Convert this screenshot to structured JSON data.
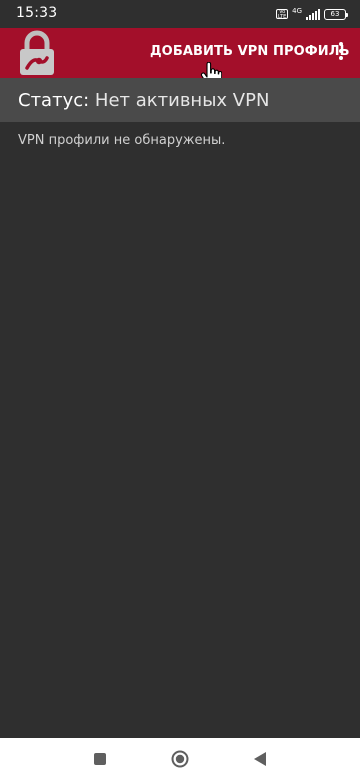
{
  "status_bar": {
    "time": "15:33",
    "volte": "Vo LTE",
    "network": "4G",
    "battery": "63"
  },
  "app_bar": {
    "add_profile_label": "ДОБАВИТЬ VPN ПРОФИЛЬ",
    "logo_icon": "lock-logo-icon",
    "overflow_icon": "more-vert-icon"
  },
  "status": {
    "label": "Статус:",
    "value": "Нет активных VPN"
  },
  "main": {
    "empty_message": "VPN профили не обнаружены."
  },
  "nav_bar": {
    "recents_icon": "square-icon",
    "home_icon": "circle-icon",
    "back_icon": "triangle-back-icon"
  },
  "colors": {
    "accent": "#a30f2a",
    "background": "#2f2f2f",
    "status_header": "#4a4a4a"
  }
}
